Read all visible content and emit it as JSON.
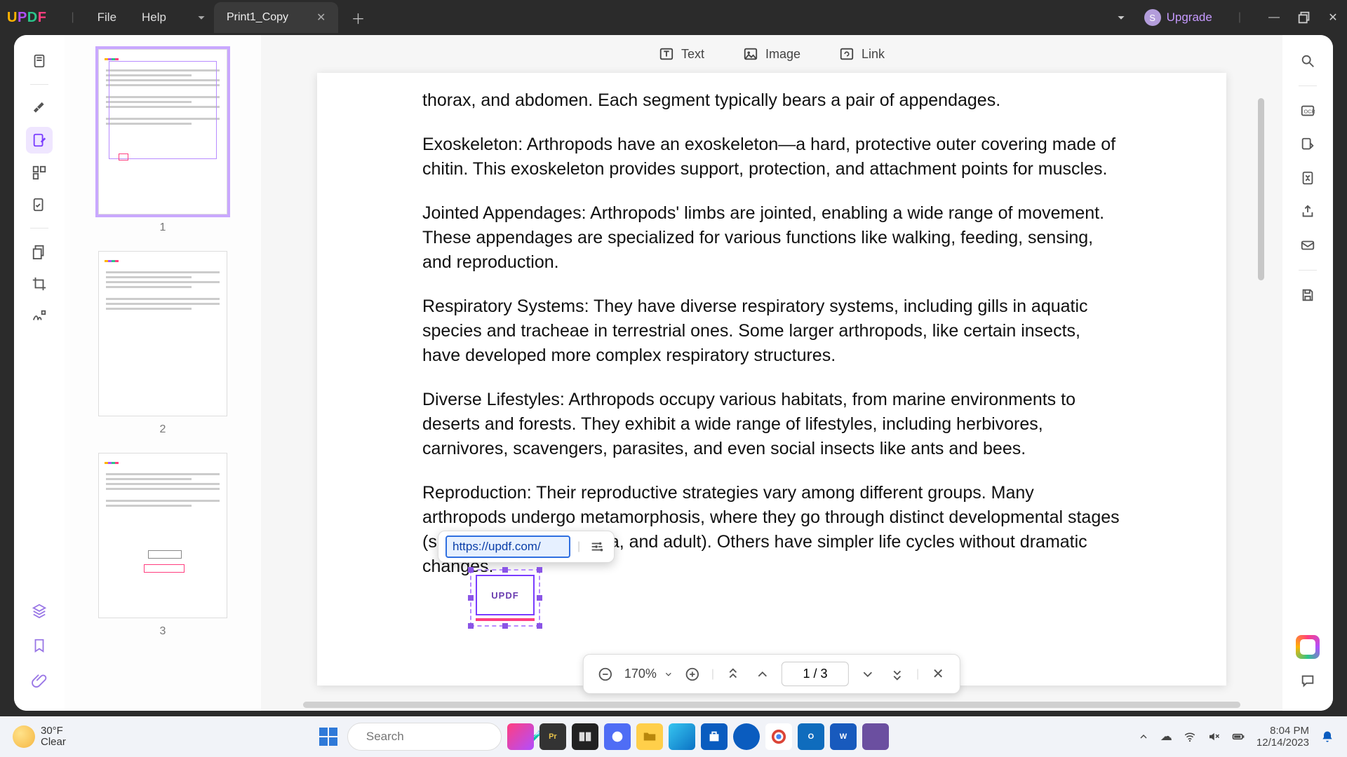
{
  "titlebar": {
    "logo_chars": [
      "U",
      "P",
      "D",
      "F"
    ],
    "menu_file": "File",
    "menu_help": "Help",
    "tab_name": "Print1_Copy",
    "upgrade_label": "Upgrade",
    "upgrade_initial": "S"
  },
  "top_edit_bar": {
    "text": "Text",
    "image": "Image",
    "link": "Link"
  },
  "doc": {
    "p1": "thorax, and abdomen. Each segment typically bears a pair of appendages.",
    "p2": "Exoskeleton: Arthropods have an exoskeleton—a hard, protective outer covering made of chitin. This exoskeleton provides support, protection, and attachment points for muscles.",
    "p3": "Jointed Appendages: Arthropods' limbs are jointed, enabling a wide range of movement. These appendages are specialized for various functions like walking, feeding, sensing, and reproduction.",
    "p4": "Respiratory Systems: They have diverse respiratory systems, including gills in aquatic species and tracheae in terrestrial ones. Some larger arthropods, like certain insects, have developed more complex respiratory structures.",
    "p5": "Diverse Lifestyles: Arthropods occupy various habitats, from marine environments to deserts and forests. They exhibit a wide range of lifestyles, including herbivores, carnivores, scavengers, parasites, and even social insects like ants and bees.",
    "p6": "Reproduction: Their reproductive strategies vary among different groups. Many arthropods undergo metamorphosis, where they go through distinct developmental stages (such as egg, larva, pupa, and adult). Others have simpler life cycles without dramatic changes."
  },
  "link_popup": {
    "url": "https://updf.com/",
    "object_label": "UPDF"
  },
  "bottombar": {
    "zoom": "170%",
    "page_current": "1",
    "page_sep": "/",
    "page_total": "3"
  },
  "thumbnails": {
    "n1": "1",
    "n2": "2",
    "n3": "3"
  },
  "weather": {
    "temp": "30°F",
    "cond": "Clear"
  },
  "search_placeholder": "Search",
  "clock": {
    "time": "8:04 PM",
    "date": "12/14/2023"
  }
}
